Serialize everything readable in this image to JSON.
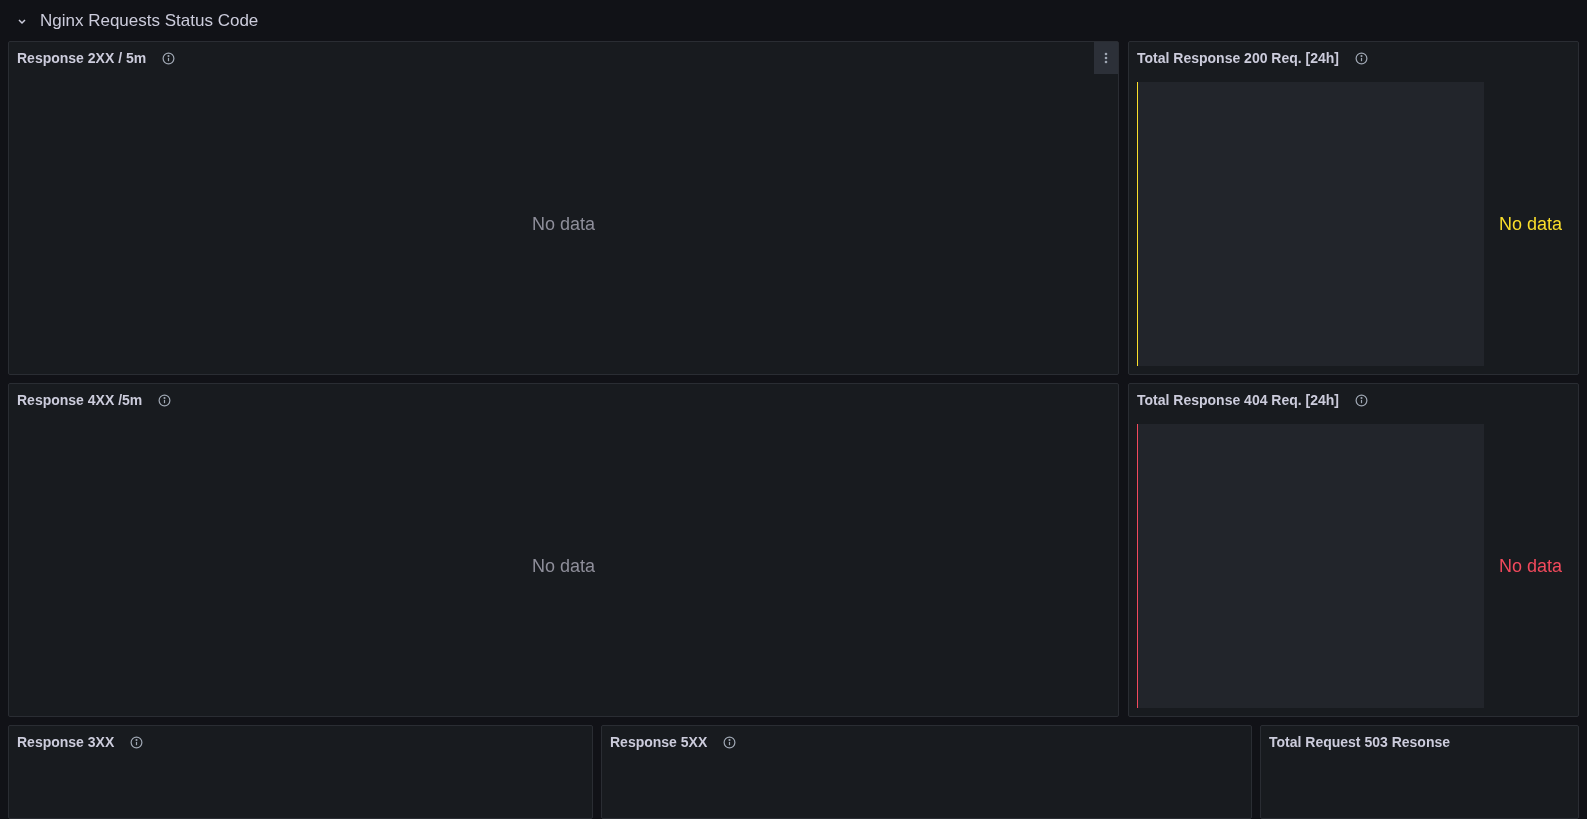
{
  "row": {
    "title": "Nginx Requests Status Code",
    "expanded": true
  },
  "panels": [
    {
      "kind": "timeseries",
      "title": "Response 2XX / 5m",
      "info": true,
      "menu": true,
      "message": "No data"
    },
    {
      "kind": "stat",
      "title": "Total Response 200 Req. [24h]",
      "info": true,
      "menu": false,
      "message": "No data",
      "color": "#fade2a"
    },
    {
      "kind": "timeseries",
      "title": "Response 4XX /5m",
      "info": true,
      "menu": false,
      "message": "No data"
    },
    {
      "kind": "stat",
      "title": "Total Response 404 Req. [24h]",
      "info": true,
      "menu": false,
      "message": "No data",
      "color": "#f2495c"
    },
    {
      "kind": "empty",
      "title": "Response 3XX",
      "info": true,
      "menu": false
    },
    {
      "kind": "empty",
      "title": "Response 5XX",
      "info": true,
      "menu": false
    },
    {
      "kind": "empty",
      "title": "Total Request 503 Resonse",
      "info": false,
      "menu": false
    }
  ]
}
